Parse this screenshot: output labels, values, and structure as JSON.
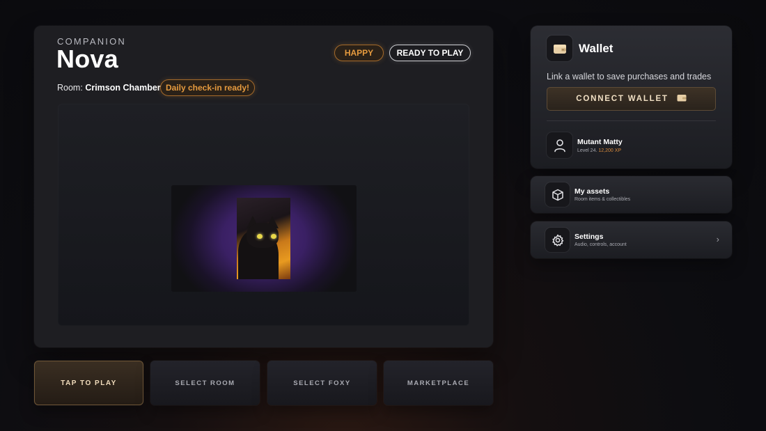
{
  "companion": {
    "eyebrow": "COMPANION",
    "name": "Nova",
    "mood_badge": "HAPPY",
    "status_badge": "READY TO PLAY",
    "room_label": "Room:",
    "room_name": "Crimson Chamber",
    "checkin_badge": "Daily check-in ready!"
  },
  "tabs": [
    {
      "label": "TAP TO PLAY",
      "active": true
    },
    {
      "label": "SELECT ROOM",
      "active": false
    },
    {
      "label": "SELECT FOXY",
      "active": false
    },
    {
      "label": "MARKETPLACE",
      "active": false
    }
  ],
  "wallet": {
    "title": "Wallet",
    "description": "Link a wallet to save purchases and trades",
    "connect_label": "CONNECT WALLET"
  },
  "user": {
    "name": "Mutant Matty",
    "level": "Level 24.",
    "xp": "12,200 XP"
  },
  "menu": {
    "assets": {
      "title": "My assets",
      "subtitle": "Room items & collectibles",
      "icon": "cube-icon"
    },
    "settings": {
      "title": "Settings",
      "subtitle": "Audio, controls, account",
      "icon": "gear-icon"
    }
  },
  "colors": {
    "accent_orange": "#e59a3e",
    "tab_active_text": "#f1dcbc",
    "panel_bg": "#1e1e22"
  }
}
